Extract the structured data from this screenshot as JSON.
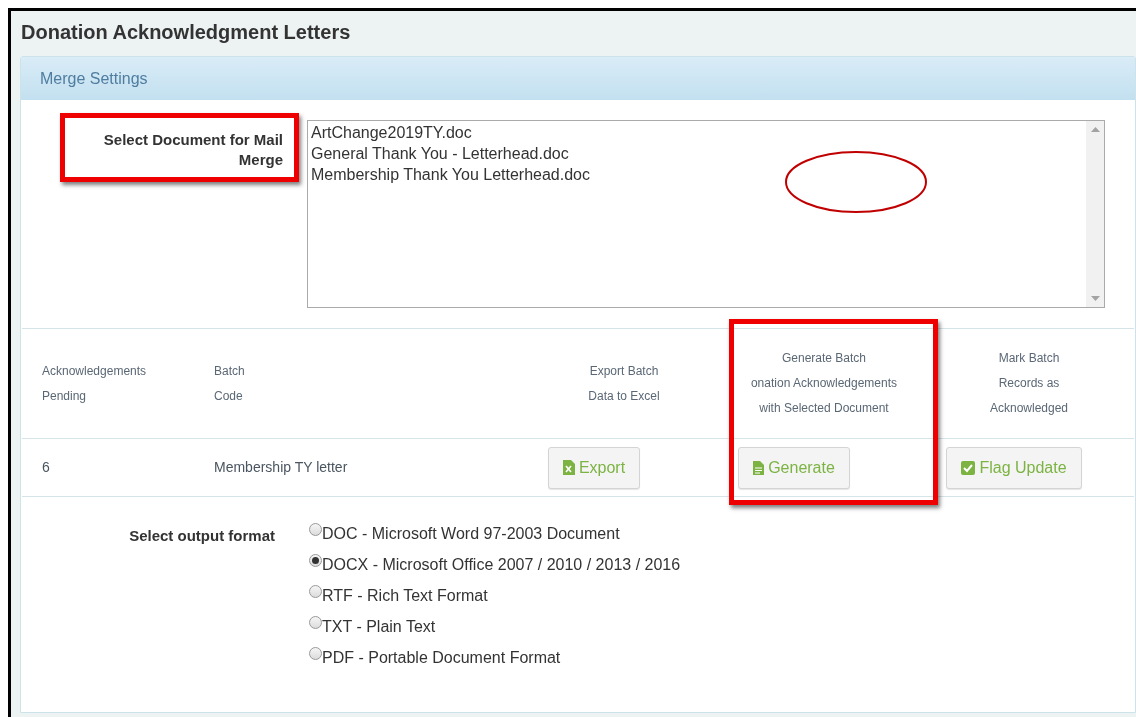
{
  "page_title": "Donation Acknowledgment Letters",
  "panel_title": "Merge Settings",
  "document_select": {
    "label": "Select Document for Mail Merge",
    "options": [
      {
        "text": "ArtChange2019TY.doc"
      },
      {
        "text": "General Thank You - Letterhead.doc"
      },
      {
        "text": "Membership Thank You Letterhead.doc"
      }
    ]
  },
  "batch_table": {
    "columns": [
      {
        "lines": [
          "Acknowledgements",
          "Pending"
        ]
      },
      {
        "lines": [
          "Batch",
          "Code"
        ]
      },
      {
        "lines": [
          "Export Batch",
          "Data to Excel"
        ]
      },
      {
        "lines": [
          "Generate Batch",
          "onation Acknowledgements",
          "with Selected Document"
        ]
      },
      {
        "lines": [
          "Mark Batch",
          "Records as",
          "Acknowledged"
        ]
      }
    ],
    "rows": [
      {
        "pending": "6",
        "batch_code": "Membership TY letter",
        "buttons": [
          {
            "label": "Export",
            "kind": "excel"
          },
          {
            "label": "Generate",
            "kind": "document"
          },
          {
            "label": "Flag Update",
            "kind": "check"
          }
        ]
      }
    ]
  },
  "output_format": {
    "label": "Select output format",
    "options": [
      {
        "text": "DOC - Microsoft Word 97-2003 Document",
        "selected": false
      },
      {
        "text": "DOCX - Microsoft Office 2007 / 2010 / 2013 / 2016",
        "selected": true
      },
      {
        "text": "RTF - Rich Text Format",
        "selected": false
      },
      {
        "text": "TXT - Plain Text",
        "selected": false
      },
      {
        "text": "PDF - Portable Document Format",
        "selected": false
      }
    ]
  }
}
